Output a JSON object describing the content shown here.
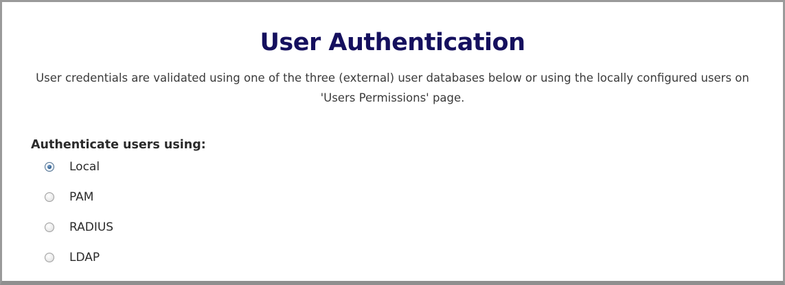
{
  "page": {
    "title": "User Authentication",
    "description": "User credentials are validated using one of the three (external) user databases below or using the locally configured users on 'Users Permissions' page."
  },
  "auth": {
    "group_label": "Authenticate users using:",
    "selected": "Local",
    "options": [
      {
        "label": "Local",
        "checked": true
      },
      {
        "label": "PAM",
        "checked": false
      },
      {
        "label": "RADIUS",
        "checked": false
      },
      {
        "label": "LDAP",
        "checked": false
      }
    ]
  },
  "colors": {
    "title": "#15105e",
    "panel_border": "#9a9a9a",
    "text": "#2b2b2b",
    "radio_selected": "#2d5d8f"
  }
}
